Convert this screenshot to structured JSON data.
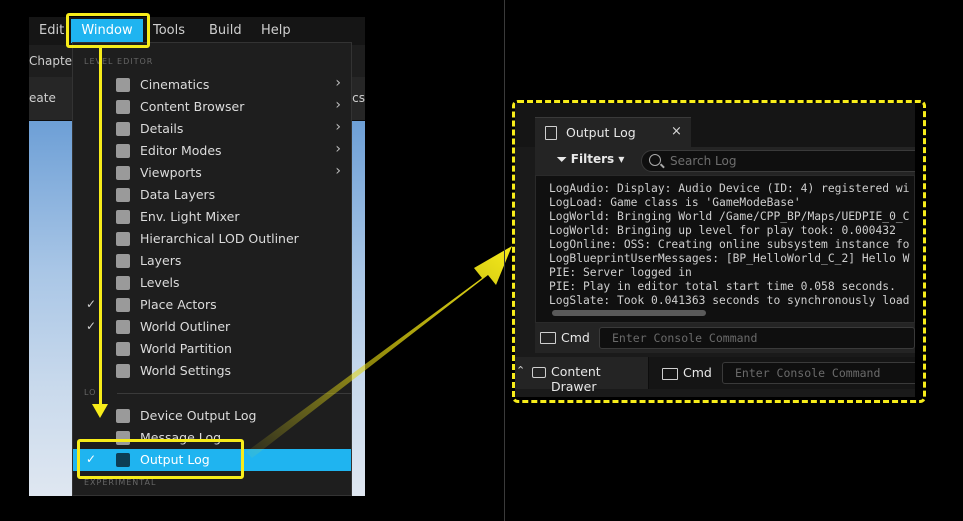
{
  "menubar": {
    "items": [
      "Edit",
      "Window",
      "Tools",
      "Build",
      "Help"
    ]
  },
  "editor": {
    "tab_fragment": "Chapter",
    "toolbar_left_fragment": "eate",
    "toolbar_right_fragment": "ics"
  },
  "window_menu": {
    "section_level_editor": "LEVEL EDITOR",
    "section_log_fragment": "LO",
    "section_experimental": "EXPERIMENTAL",
    "items": [
      {
        "label": "Cinematics",
        "icon": "cinematics-icon",
        "submenu": true,
        "checked": false
      },
      {
        "label": "Content Browser",
        "icon": "content-browser-icon",
        "submenu": true,
        "checked": false
      },
      {
        "label": "Details",
        "icon": "details-icon",
        "submenu": true,
        "checked": false
      },
      {
        "label": "Editor Modes",
        "icon": "editor-modes-icon",
        "submenu": true,
        "checked": false
      },
      {
        "label": "Viewports",
        "icon": "viewports-icon",
        "submenu": true,
        "checked": false
      },
      {
        "label": "Data Layers",
        "icon": "data-layers-icon",
        "submenu": false,
        "checked": false
      },
      {
        "label": "Env. Light Mixer",
        "icon": "light-mixer-icon",
        "submenu": false,
        "checked": false
      },
      {
        "label": "Hierarchical LOD Outliner",
        "icon": "hlod-icon",
        "submenu": false,
        "checked": false
      },
      {
        "label": "Layers",
        "icon": "layers-icon",
        "submenu": false,
        "checked": false
      },
      {
        "label": "Levels",
        "icon": "levels-icon",
        "submenu": false,
        "checked": false
      },
      {
        "label": "Place Actors",
        "icon": "place-actors-icon",
        "submenu": false,
        "checked": true
      },
      {
        "label": "World Outliner",
        "icon": "world-outliner-icon",
        "submenu": false,
        "checked": true
      },
      {
        "label": "World Partition",
        "icon": "world-partition-icon",
        "submenu": false,
        "checked": false
      },
      {
        "label": "World Settings",
        "icon": "world-settings-icon",
        "submenu": false,
        "checked": false
      }
    ],
    "log_items": [
      {
        "label": "Device Output Log",
        "icon": "device-output-log-icon",
        "checked": false
      },
      {
        "label": "Message Log",
        "icon": "message-log-icon",
        "checked": false
      },
      {
        "label": "Output Log",
        "icon": "output-log-icon",
        "checked": true,
        "selected": true
      }
    ],
    "check_glyph": "✓",
    "arrow_glyph": "›"
  },
  "output_log": {
    "tab_title": "Output Log",
    "close_glyph": "×",
    "filters_label": "Filters",
    "search_placeholder": "Search Log",
    "lines": [
      "LogAudio: Display: Audio Device (ID: 4) registered wi",
      "LogLoad: Game class is 'GameModeBase'",
      "LogWorld: Bringing World /Game/CPP_BP/Maps/UEDPIE_0_C",
      "LogWorld: Bringing up level for play took: 0.000432",
      "LogOnline: OSS: Creating online subsystem instance fo",
      "LogBlueprintUserMessages: [BP_HelloWorld_C_2] Hello W",
      "PIE: Server logged in",
      "PIE: Play in editor total start time 0.058 seconds.",
      "LogSlate: Took 0.041363 seconds to synchronously load"
    ],
    "cmd_label": "Cmd",
    "console_placeholder": "Enter Console Command"
  },
  "statusbar": {
    "content_drawer_label": "Content Drawer",
    "cmd_label": "Cmd",
    "console_placeholder": "Enter Console Command"
  },
  "colors": {
    "highlight": "#1fb4f0",
    "annotation": "#f7ec1a",
    "menu_bg": "#1e1e1e"
  }
}
